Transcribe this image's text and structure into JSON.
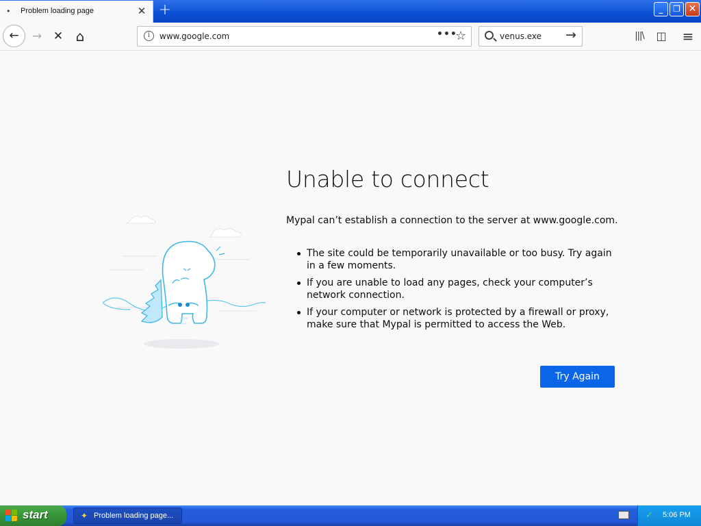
{
  "window": {
    "tab_title": "Problem loading page",
    "tab_dot": "•",
    "tab_close": "✕",
    "new_tab": "+",
    "minimize": "_",
    "restore": "❐",
    "close": "✕"
  },
  "navbar": {
    "back": "←",
    "forward": "→",
    "stop": "✕",
    "home": "⌂",
    "url_info": "i",
    "url": "www.google.com",
    "page_actions": "•••",
    "bookmark_star": "☆",
    "search_value": "venus.exe",
    "search_go": "→",
    "library": "|||\\",
    "sidebar": "◫",
    "menu": "≡"
  },
  "error_page": {
    "title": "Unable to connect",
    "description": "Mypal can’t establish a connection to the server at www.google.com.",
    "bullets": [
      "The site could be temporarily unavailable or too busy. Try again in a few moments.",
      "If you are unable to load any pages, check your computer’s network connection.",
      "If your computer or network is protected by a firewall or proxy, make sure that Mypal is permitted to access the Web."
    ],
    "try_again": "Try Again"
  },
  "taskbar": {
    "start": "start",
    "task_title": "Problem loading page...",
    "task_icon": "✦",
    "tray_icon": "✓",
    "clock": "5:06 PM"
  },
  "colors": {
    "accent": "#0a66e6",
    "taskbar_blue": "#245edb",
    "start_green": "#3a9a3a",
    "tray_blue": "#0f86d8"
  }
}
